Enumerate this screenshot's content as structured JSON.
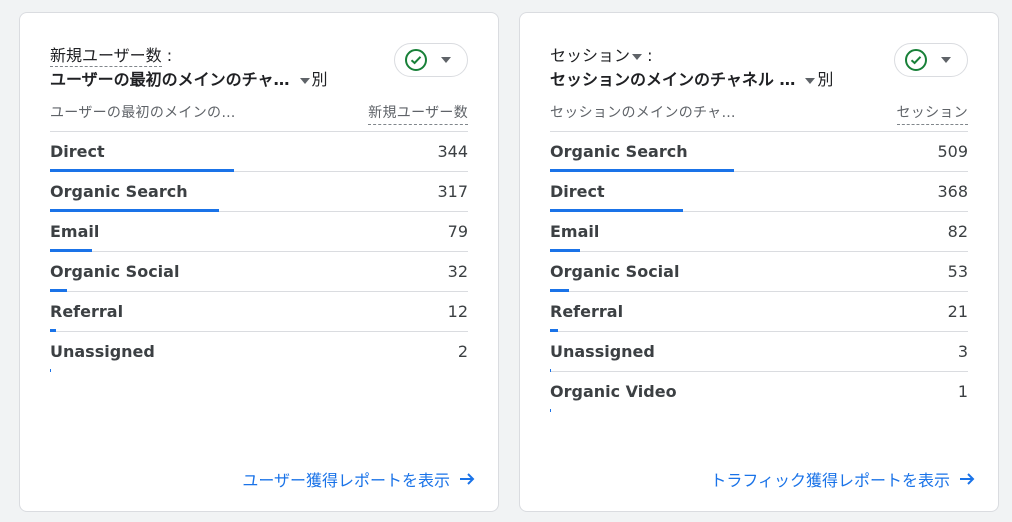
{
  "cards": [
    {
      "title_metric": "新規ユーザー数",
      "title_colon": ":",
      "title_dimension": "ユーザーの最初のメインのチャ…",
      "title_suffix": "別",
      "col_dimension": "ユーザーの最初のメインの…",
      "col_metric": "新規ユーザー数",
      "max": 344,
      "rows": [
        {
          "label": "Direct",
          "value": "344",
          "v": 344
        },
        {
          "label": "Organic Search",
          "value": "317",
          "v": 317
        },
        {
          "label": "Email",
          "value": "79",
          "v": 79
        },
        {
          "label": "Organic Social",
          "value": "32",
          "v": 32
        },
        {
          "label": "Referral",
          "value": "12",
          "v": 12
        },
        {
          "label": "Unassigned",
          "value": "2",
          "v": 2
        }
      ],
      "link_label": "ユーザー獲得レポートを表示"
    },
    {
      "title_metric": "セッション",
      "title_colon": ":",
      "title_dimension": "セッションのメインのチャネル …",
      "title_suffix": "別",
      "col_dimension": "セッションのメインのチャ…",
      "col_metric": "セッション",
      "max": 509,
      "rows": [
        {
          "label": "Organic Search",
          "value": "509",
          "v": 509
        },
        {
          "label": "Direct",
          "value": "368",
          "v": 368
        },
        {
          "label": "Email",
          "value": "82",
          "v": 82
        },
        {
          "label": "Organic Social",
          "value": "53",
          "v": 53
        },
        {
          "label": "Referral",
          "value": "21",
          "v": 21
        },
        {
          "label": "Unassigned",
          "value": "3",
          "v": 3
        },
        {
          "label": "Organic Video",
          "value": "1",
          "v": 1
        }
      ],
      "link_label": "トラフィック獲得レポートを表示"
    }
  ],
  "colors": {
    "accent": "#1a73e8",
    "success": "#188038",
    "divider": "#dadce0"
  },
  "icons": {
    "status": "check-circle-icon",
    "dropdown": "caret-down-icon",
    "link": "arrow-right-icon"
  }
}
